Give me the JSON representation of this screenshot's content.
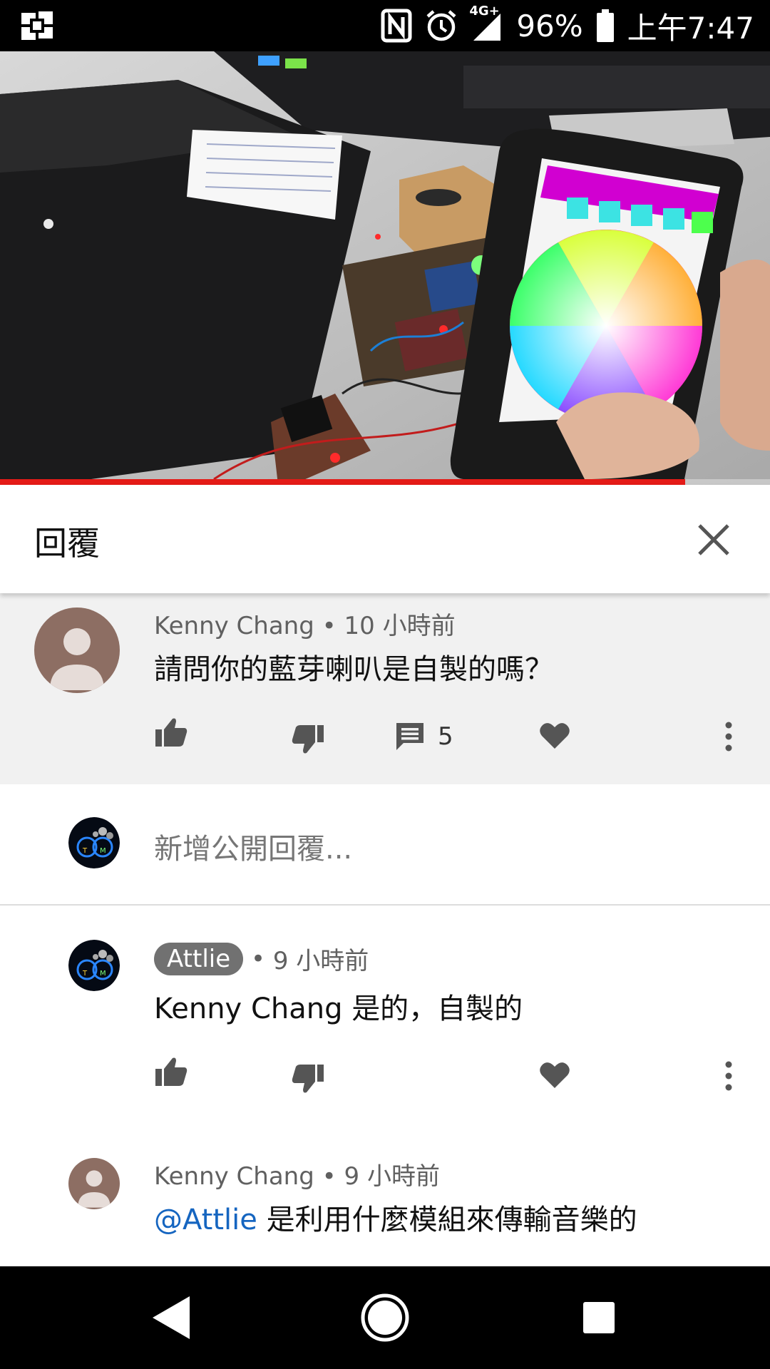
{
  "status_bar": {
    "network": "4G+",
    "battery": "96%",
    "time": "上午7:47"
  },
  "video": {
    "progress": 0.89
  },
  "reply_panel": {
    "title": "回覆"
  },
  "parent_comment": {
    "author": "Kenny Chang",
    "time": "10 小時前",
    "text": "請問你的藍芽喇叭是自製的嗎？",
    "reply_count": "5"
  },
  "add_reply": {
    "placeholder": "新增公開回覆..."
  },
  "replies": [
    {
      "author": "Attlie",
      "time": "9 小時前",
      "text": "Kenny Chang 是的，自製的"
    },
    {
      "author": "Kenny Chang",
      "time": "9 小時前",
      "mention": "@Attlie",
      "text": " 是利用什麼模組來傳輸音樂的"
    }
  ],
  "colors": {
    "progress": "#e41b17",
    "mention": "#1565c0",
    "badge": "#717171"
  },
  "icons": {
    "like": "thumb-up-icon",
    "dislike": "thumb-down-icon",
    "reply": "comment-icon",
    "heart": "heart-icon",
    "more": "more-vert-icon",
    "close": "close-icon",
    "back": "back-triangle-icon",
    "home": "home-circle-icon",
    "recents": "recents-square-icon"
  }
}
